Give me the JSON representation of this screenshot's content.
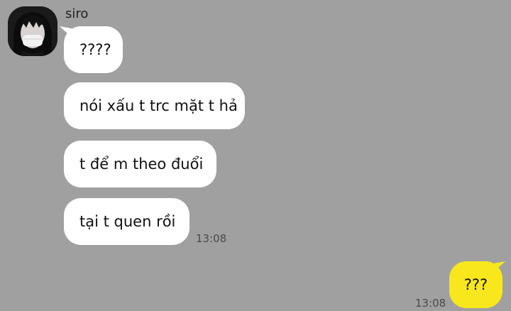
{
  "contact": {
    "name": "siro",
    "avatar_icon": "profile-photo-masked-person"
  },
  "messages_in": [
    {
      "text": "????"
    },
    {
      "text": "nói xấu t trc mặt t hả"
    },
    {
      "text": "t để m theo đuổi"
    },
    {
      "text": "tại t quen rồi"
    }
  ],
  "time_in": "13:08",
  "messages_out": [
    {
      "text": "???"
    }
  ],
  "time_out": "13:08",
  "colors": {
    "background": "#a0a0a0",
    "incoming_bubble": "#ffffff",
    "outgoing_bubble": "#f8e71c"
  }
}
